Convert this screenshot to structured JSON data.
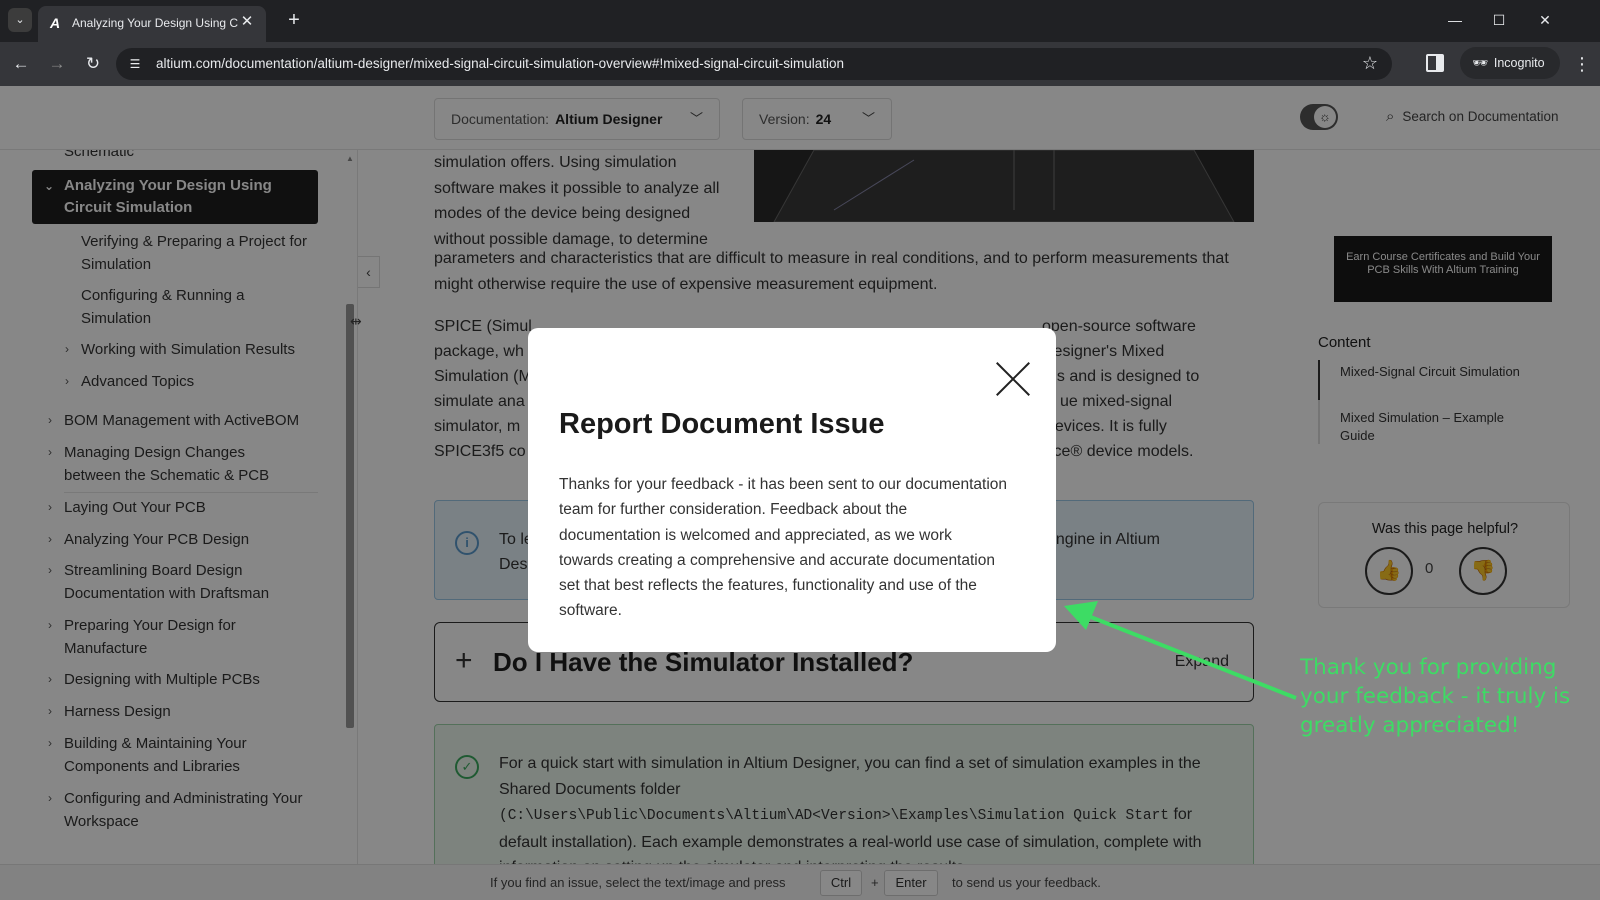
{
  "browser": {
    "tab_title": "Analyzing Your Design Using Ci",
    "favicon": "A",
    "url": "altium.com/documentation/altium-designer/mixed-signal-circuit-simulation-overview#!mixed-signal-circuit-simulation",
    "incognito_label": "Incognito"
  },
  "header": {
    "doc_label": "Documentation:",
    "doc_value": "Altium Designer",
    "version_label": "Version:",
    "version_value": "24",
    "search_label": "Search on Documentation"
  },
  "sidebar": {
    "partial_top": "Schematic",
    "active": "Analyzing Your Design Using Circuit Simulation",
    "sub_items": [
      "Verifying & Preparing a Project for Simulation",
      "Configuring & Running a Simulation",
      "Working with Simulation Results",
      "Advanced Topics"
    ],
    "items": [
      "BOM Management with ActiveBOM",
      "Managing Design Changes between the Schematic & PCB",
      "Laying Out Your PCB",
      "Analyzing Your PCB Design",
      "Streamlining Board Design Documentation with Draftsman",
      "Preparing Your Design for Manufacture",
      "Designing with Multiple PCBs",
      "Harness Design",
      "Building & Maintaining Your Components and Libraries",
      "Configuring and Administrating Your Workspace"
    ]
  },
  "main": {
    "para1_left": "simulation offers. Using simulation software makes it possible to analyze all modes of the device being designed without possible damage, to determine",
    "para1_rest": "parameters and characteristics that are difficult to measure in real conditions, and to perform measurements that might otherwise require the use of expensive measurement equipment.",
    "para2_left": "SPICE (Simul",
    "para2_right": "open-source software",
    "para2_line2_left": "package, wh",
    "para2_line2_right": "Designer's Mixed",
    "para2_line3_left": "Simulation (M",
    "para2_line3_right": "ns and is designed to",
    "para2_line4_left": "simulate ana",
    "para2_line4_right": "ue mixed-signal",
    "para2_line5_left": "simulator, m",
    "para2_line5_right": "devices. It is fully",
    "para2_line6_left": "SPICE3f5 co",
    "para2_line6_right": "ice® device models.",
    "info_left": "To le",
    "info_left2": "Des",
    "info_right": "engine in Altium",
    "expander_title": "Do I Have the Simulator Installed?",
    "expander_link": "Expand",
    "tip_line1": "For a quick start with simulation in Altium Designer, you can find a set of simulation examples in the Shared Documents folder",
    "tip_path": "(C:\\Users\\Public\\Documents\\Altium\\AD<Version>\\Examples\\Simulation Quick Start",
    "tip_after_path": " for default installation). Each example demonstrates a real-world use case of simulation, complete",
    "tip_line_cut": "with information on setting up the simulator and interpreting the results."
  },
  "right": {
    "promo": "Earn Course Certificates and Build Your PCB Skills With Altium Training",
    "content_heading": "Content",
    "toc": [
      "Mixed-Signal Circuit Simulation",
      "Mixed Simulation – Example Guide"
    ],
    "helpful_question": "Was this page helpful?",
    "vote_count": "0"
  },
  "footer": {
    "text1": "If you find an issue, select the text/image and press",
    "key1": "Ctrl",
    "plus": "+",
    "key2": "Enter",
    "text2": "to send us your feedback."
  },
  "modal": {
    "title": "Report Document Issue",
    "body": "Thanks for your feedback - it has been sent to our documentation team for further consideration. Feedback about the documentation is welcomed and appreciated, as we work towards creating a comprehensive and accurate documentation set that best reflects the features, functionality and use of the software."
  },
  "annotation": {
    "text": "Thank you for providing your feedback - it truly is greatly appreciated!",
    "color": "#3ddc64"
  }
}
